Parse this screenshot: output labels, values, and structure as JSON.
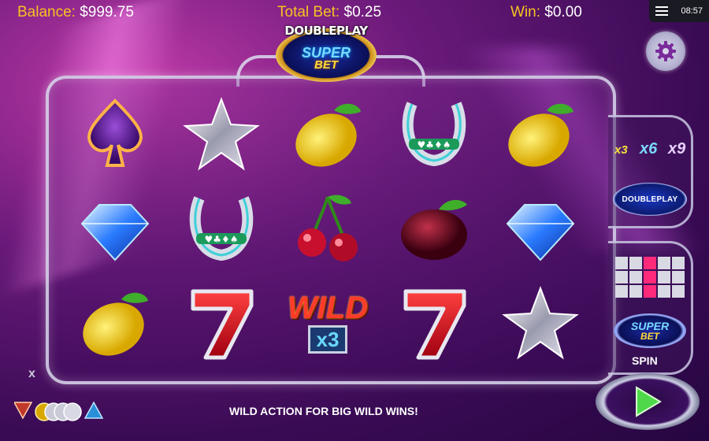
{
  "header": {
    "balance_label": "Balance:",
    "balance_value": "$999.75",
    "total_bet_label": "Total Bet:",
    "total_bet_value": "$0.25",
    "win_label": "Win:",
    "win_value": "$0.00",
    "clock": "08:57"
  },
  "logo": {
    "line1": "DOUBLEPLAY",
    "line2": "SUPER",
    "line3": "BET"
  },
  "reels": [
    [
      "spade-icon",
      "star-icon",
      "lemon-icon",
      "horseshoe-icon",
      "lemon-icon"
    ],
    [
      "diamond-icon",
      "horseshoe-icon",
      "cherry-icon",
      "plum-icon",
      "diamond-icon"
    ],
    [
      "lemon-icon",
      "seven-icon",
      "wild-icon",
      "seven-icon",
      "star-icon"
    ]
  ],
  "wild_symbol": {
    "word": "WILD",
    "multiplier": "x3"
  },
  "side_panel": {
    "multipliers": [
      "x3",
      "x6",
      "x9"
    ],
    "doubleplay_label": "DOUBLEPLAY",
    "superbet_line1": "SUPER",
    "superbet_line2": "BET",
    "spin_label": "SPIN"
  },
  "footer": {
    "tagline": "WILD ACTION FOR BIG WILD WINS!",
    "close_mark": "x"
  },
  "colors": {
    "gold": "#f5c320",
    "accent_blue": "#7ad9ff",
    "line_highlight": "#ff2a7a"
  }
}
